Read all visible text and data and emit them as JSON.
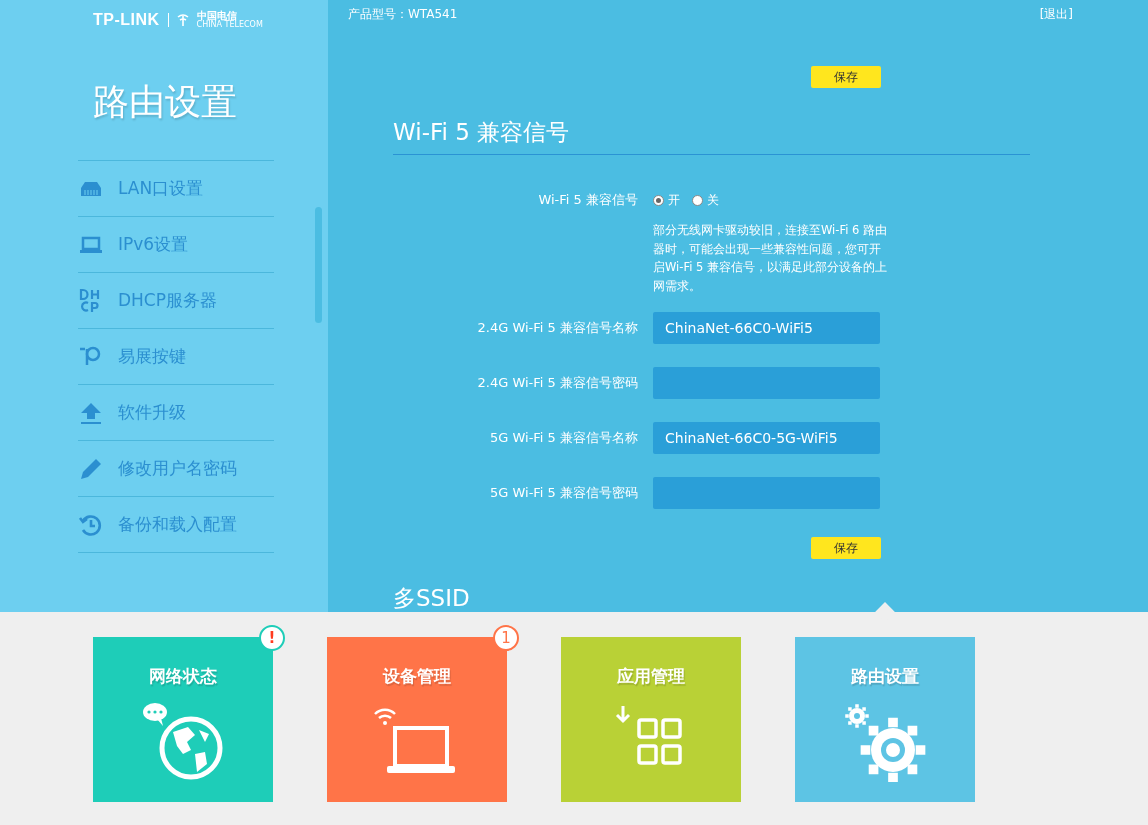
{
  "header": {
    "brand": "TP-LINK",
    "partner": "中国电信",
    "partner_en": "CHINA TELECOM",
    "product_model": "产品型号：WTA541",
    "logout": "[退出]"
  },
  "sidebar": {
    "title": "路由设置",
    "items": [
      {
        "label": "LAN口设置",
        "selected": false
      },
      {
        "label": "IPv6设置",
        "selected": false
      },
      {
        "label": "DHCP服务器",
        "selected": false
      },
      {
        "label": "易展按键",
        "selected": false
      },
      {
        "label": "软件升级",
        "selected": false
      },
      {
        "label": "修改用户名密码",
        "selected": false
      },
      {
        "label": "备份和载入配置",
        "selected": false
      }
    ]
  },
  "main": {
    "save_top": "保存",
    "section_title": "Wi-Fi 5 兼容信号",
    "switch_row": {
      "label": "Wi-Fi 5 兼容信号",
      "options": [
        {
          "label": "开",
          "selected": true
        },
        {
          "label": "关",
          "selected": false
        }
      ]
    },
    "note": "部分无线网卡驱动较旧，连接至Wi-Fi 6 路由器时，可能会出现一些兼容性问题，您可开启Wi-Fi 5 兼容信号，以满足此部分设备的上网需求。",
    "fields": [
      {
        "label": "2.4G Wi-Fi 5 兼容信号名称",
        "value": "ChinaNet-66C0-WiFi5"
      },
      {
        "label": "2.4G Wi-Fi 5 兼容信号密码"
      },
      {
        "label": "5G Wi-Fi 5 兼容信号名称",
        "value": "ChinaNet-66C0-5G-WiFi5"
      },
      {
        "label": "5G Wi-Fi 5 兼容信号密码"
      }
    ],
    "save_bottom": "保存",
    "next_section_title": "多SSID"
  },
  "tiles": [
    {
      "label": "网络状态",
      "badge": "!",
      "color": "#1ecdb8",
      "selected": false
    },
    {
      "label": "设备管理",
      "badge": "1",
      "color": "#ff7448",
      "selected": false
    },
    {
      "label": "应用管理",
      "color": "#b9d136",
      "selected": false
    },
    {
      "label": "路由设置",
      "color": "#5dc4e4",
      "selected": true
    }
  ]
}
